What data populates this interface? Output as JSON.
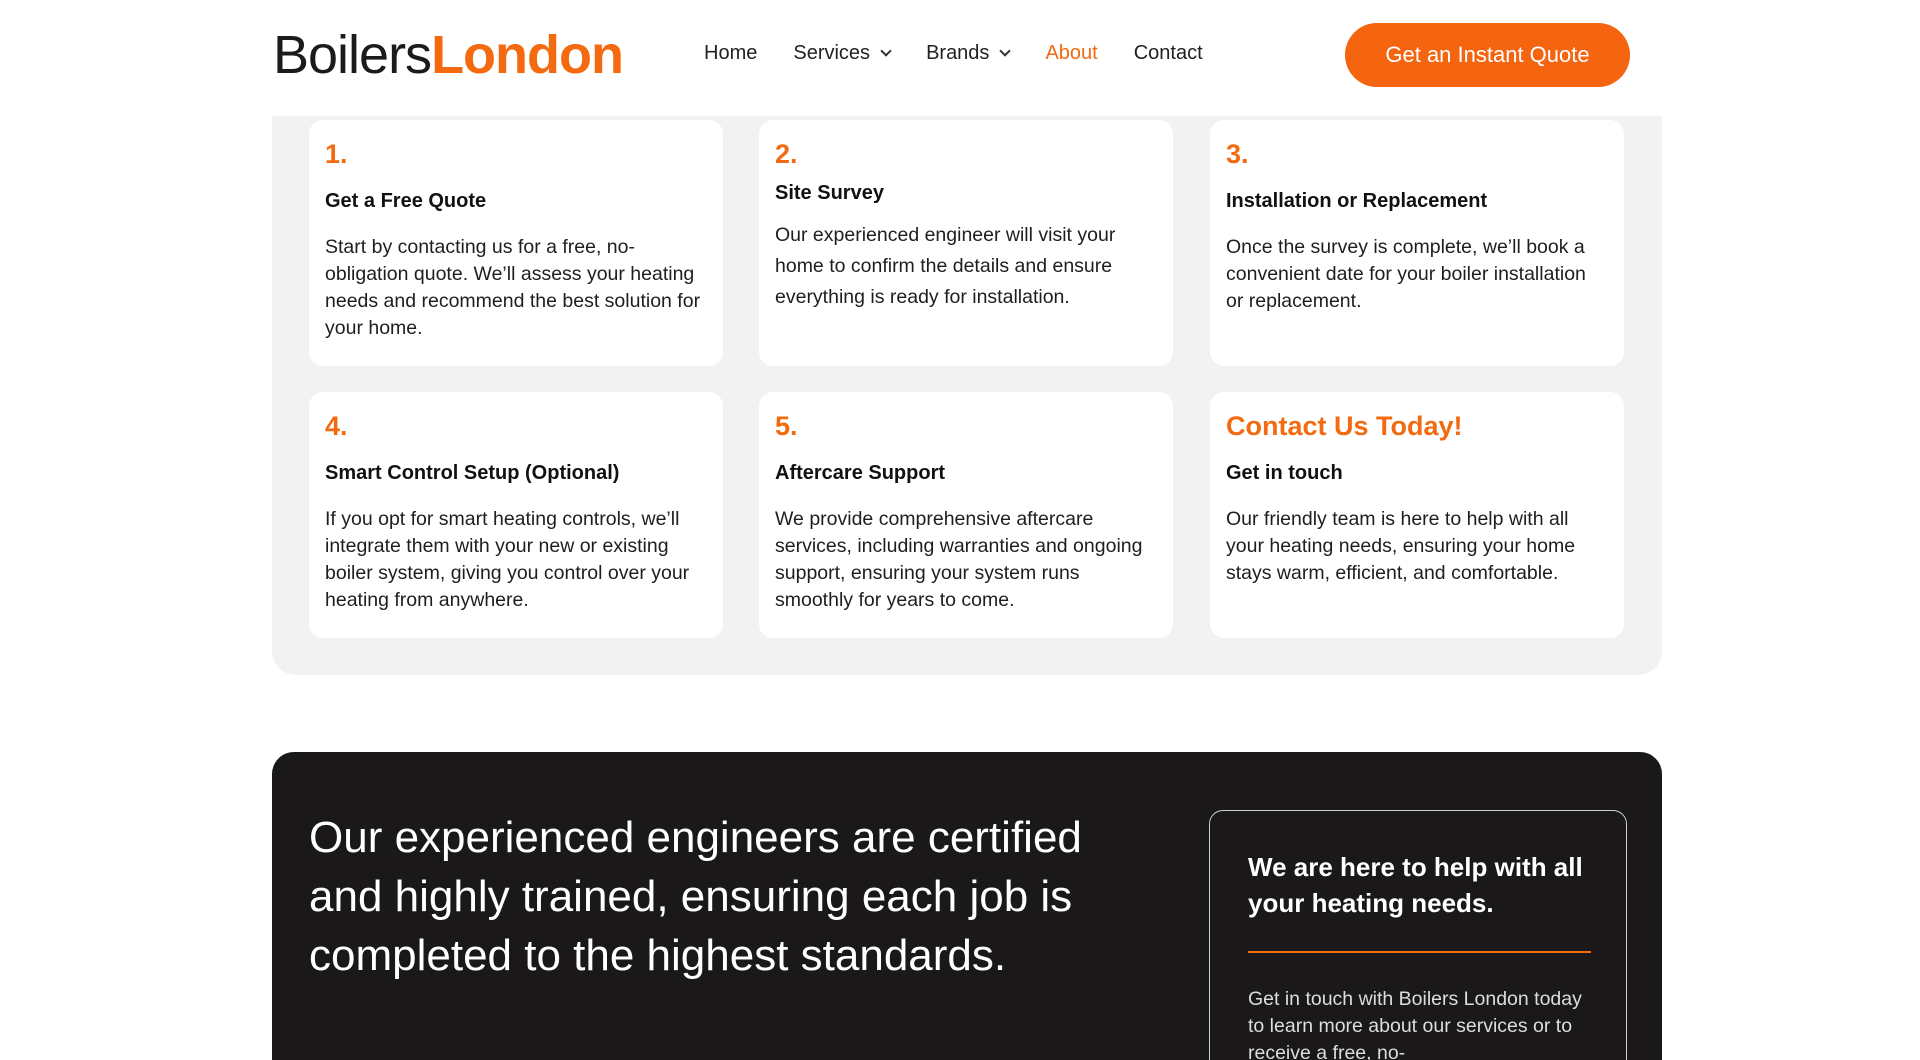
{
  "brand": {
    "part1": "Boilers",
    "part2": "London",
    "accent": "#f36a10"
  },
  "nav": {
    "home": "Home",
    "services": "Services",
    "brands": "Brands",
    "about": "About",
    "contact": "Contact"
  },
  "cta": {
    "label": "Get an Instant Quote"
  },
  "steps": [
    {
      "num": "1.",
      "title": "Get a Free Quote",
      "text": "Start by contacting us for a free, no-obligation quote. We’ll assess your heating needs and recommend the best solution for your home."
    },
    {
      "num": "2.",
      "title": "Site Survey",
      "text": "Our experienced engineer will visit your home to confirm the details and ensure everything is ready for installation."
    },
    {
      "num": "3.",
      "title": "Installation or Replacement",
      "text": "Once the survey is complete, we’ll book a convenient date for your boiler installation or replacement."
    },
    {
      "num": "4.",
      "title": "Smart Control Setup  (Optional)",
      "text": "If you opt for smart heating controls, we’ll  integrate them with your new or existing boiler system, giving you control over your heating from anywhere."
    },
    {
      "num": "5.",
      "title": "Aftercare Support",
      "text": "We provide comprehensive aftercare services, including warranties and ongoing support, ensuring your system runs smoothly for years to come."
    },
    {
      "num": "Contact Us Today!",
      "title": "Get in touch",
      "text": "Our friendly team is here to help with all your heating needs, ensuring your home stays warm, efficient, and comfortable."
    }
  ],
  "dark_section": {
    "heading": "Our experienced engineers are certified and highly trained, ensuring each job is completed to the highest standards.",
    "help_title": "We are here to help with all your heating needs.",
    "help_text": "Get in touch with  Boilers London today to learn more about our services or to receive a free, no-"
  }
}
